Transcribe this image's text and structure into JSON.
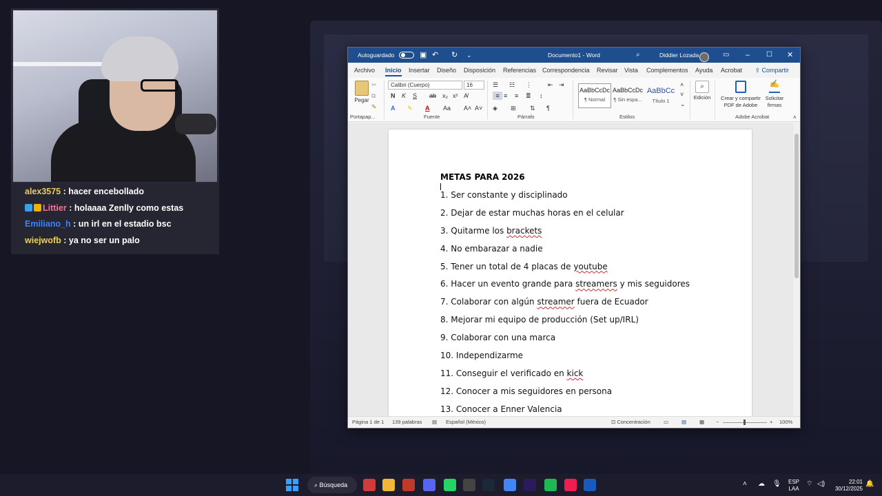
{
  "chat": [
    {
      "user": "alex3575",
      "message": ": hacer encebollado",
      "color": "#e8c96b",
      "badges": []
    },
    {
      "user": "Littier",
      "message": ": holaaaa Zenlly como estas",
      "color": "#ff6f91",
      "badges": [
        "#3aa0e8",
        "#f0b000"
      ]
    },
    {
      "user": "Emiliano_h",
      "message": ": un irl en el estadio bsc",
      "color": "#3b82f6",
      "badges": []
    },
    {
      "user": "wiejwofb",
      "message": ": ya no ser un palo",
      "color": "#f2d04c",
      "badges": []
    }
  ],
  "word": {
    "titlebar": {
      "autosave": "Autoguardado",
      "title": "Documento1 - Word",
      "user": "Diddier Lozada"
    },
    "tabs": [
      "Archivo",
      "Inicio",
      "Insertar",
      "Diseño",
      "Disposición",
      "Referencias",
      "Correspondencia",
      "Revisar",
      "Vista",
      "Complementos",
      "Ayuda",
      "Acrobat"
    ],
    "active_tab": "Inicio",
    "share_label": "Compartir",
    "ribbon": {
      "paste_label": "Pegar",
      "font_name": "Calibri (Cuerpo)",
      "font_size": "16",
      "bold": "N",
      "italic": "K",
      "underline": "S",
      "styles": [
        {
          "preview": "AaBbCcDc",
          "name": "¶ Normal"
        },
        {
          "preview": "AaBbCcDc",
          "name": "¶ Sin espa..."
        },
        {
          "preview": "AaBbCc",
          "name": "Título 1"
        }
      ],
      "edit_label": "Edición",
      "adobe_create": "Crear y compartir PDF de Adobe",
      "adobe_sign": "Solicitar firmas",
      "group_labels": {
        "clipboard": "Portapap...",
        "font": "Fuente",
        "paragraph": "Párrafo",
        "styles": "Estilos",
        "adobe": "Adobe Acrobat"
      }
    },
    "document": {
      "title": "METAS PARA 2026",
      "items": [
        {
          "parts": [
            {
              "t": "1. Ser constante y disciplinado"
            }
          ]
        },
        {
          "parts": [
            {
              "t": "2. Dejar de estar muchas horas en el celular"
            }
          ]
        },
        {
          "parts": [
            {
              "t": "3. Quitarme los "
            },
            {
              "t": "brackets",
              "sq": true
            }
          ]
        },
        {
          "parts": [
            {
              "t": "4. No embarazar a nadie"
            }
          ]
        },
        {
          "parts": [
            {
              "t": "5. Tener un total de 4 placas de "
            },
            {
              "t": "youtube",
              "sq": true
            }
          ]
        },
        {
          "parts": [
            {
              "t": "6. Hacer un evento grande para "
            },
            {
              "t": "streamers",
              "sq": true
            },
            {
              "t": " y mis seguidores"
            }
          ]
        },
        {
          "parts": [
            {
              "t": "7. Colaborar con algún "
            },
            {
              "t": "streamer",
              "sq": true
            },
            {
              "t": " fuera de Ecuador"
            }
          ]
        },
        {
          "parts": [
            {
              "t": "8. Mejorar mi equipo de producción (Set up/IRL)"
            }
          ]
        },
        {
          "parts": [
            {
              "t": "9. Colaborar con una marca"
            }
          ]
        },
        {
          "parts": [
            {
              "t": "10. Independizarme"
            }
          ]
        },
        {
          "parts": [
            {
              "t": "11. Conseguir el verificado en "
            },
            {
              "t": "kick",
              "sq": true
            }
          ]
        },
        {
          "parts": [
            {
              "t": "12. Conocer a mis seguidores en persona"
            }
          ]
        },
        {
          "parts": [
            {
              "t": "13. Conocer a Enner Valencia"
            }
          ]
        }
      ]
    },
    "statusbar": {
      "page": "Página 1 de 1",
      "words": "139 palabras",
      "language": "Español (México)",
      "focus": "Concentración",
      "zoom": "100%"
    }
  },
  "taskbar": {
    "search": "Búsqueda",
    "lang": "ESP",
    "lang2": "LAA",
    "time": "22:01",
    "date": "30/12/2025",
    "apps": [
      {
        "name": "widgets-icon",
        "color": "#d23b3b"
      },
      {
        "name": "file-explorer-icon",
        "color": "#f0b73b"
      },
      {
        "name": "calendar-app-icon",
        "color": "#c0392b"
      },
      {
        "name": "discord-icon",
        "color": "#5865f2"
      },
      {
        "name": "whatsapp-icon",
        "color": "#25d366"
      },
      {
        "name": "epic-games-icon",
        "color": "#444444"
      },
      {
        "name": "steam-icon",
        "color": "#1b2838"
      },
      {
        "name": "chrome-icon",
        "color": "#4285f4"
      },
      {
        "name": "premiere-icon",
        "color": "#2a1b5a"
      },
      {
        "name": "spotify-icon",
        "color": "#1db954"
      },
      {
        "name": "tiktok-icon",
        "color": "#ee1d52"
      },
      {
        "name": "word-icon",
        "color": "#185abd"
      }
    ]
  },
  "colors": {
    "word_blue": "#1f4e8f",
    "spell_red": "#d12b2b"
  }
}
